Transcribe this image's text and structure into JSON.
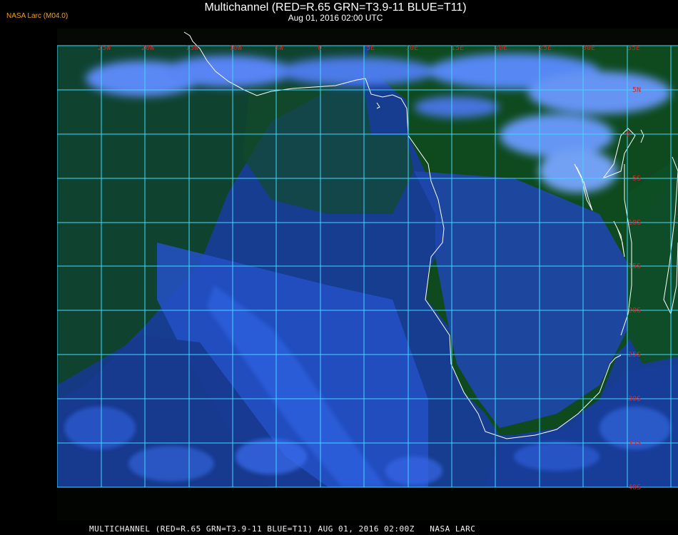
{
  "header": {
    "brand": "NASA Larc (M04.0)",
    "title": "Multichannel (RED=R.65 GRN=T3.9-11 BLUE=T11)",
    "subtitle": "Aug 01, 2016 02:00 UTC"
  },
  "footer": {
    "text": "MULTICHANNEL (RED=R.65 GRN=T3.9-11 BLUE=T11) AUG 01, 2016 02:00Z   NASA LARC"
  },
  "map": {
    "region": "Southern Africa and South Atlantic",
    "lon_labels": [
      "25W",
      "20W",
      "15W",
      "10W",
      "5W",
      "0",
      "5E",
      "10E",
      "15E",
      "20E",
      "25E",
      "30E",
      "35E"
    ],
    "lat_labels": [
      "5N",
      "0",
      "5S",
      "10S",
      "15S",
      "20S",
      "25S",
      "30S",
      "35S",
      "40S"
    ],
    "colors": {
      "grid": "#40d8ff",
      "label": "#dd2222",
      "coastline": "#ffffff",
      "land": "#0c4218",
      "ocean": "#1f48b8",
      "cloud": "#5f8dff"
    }
  }
}
